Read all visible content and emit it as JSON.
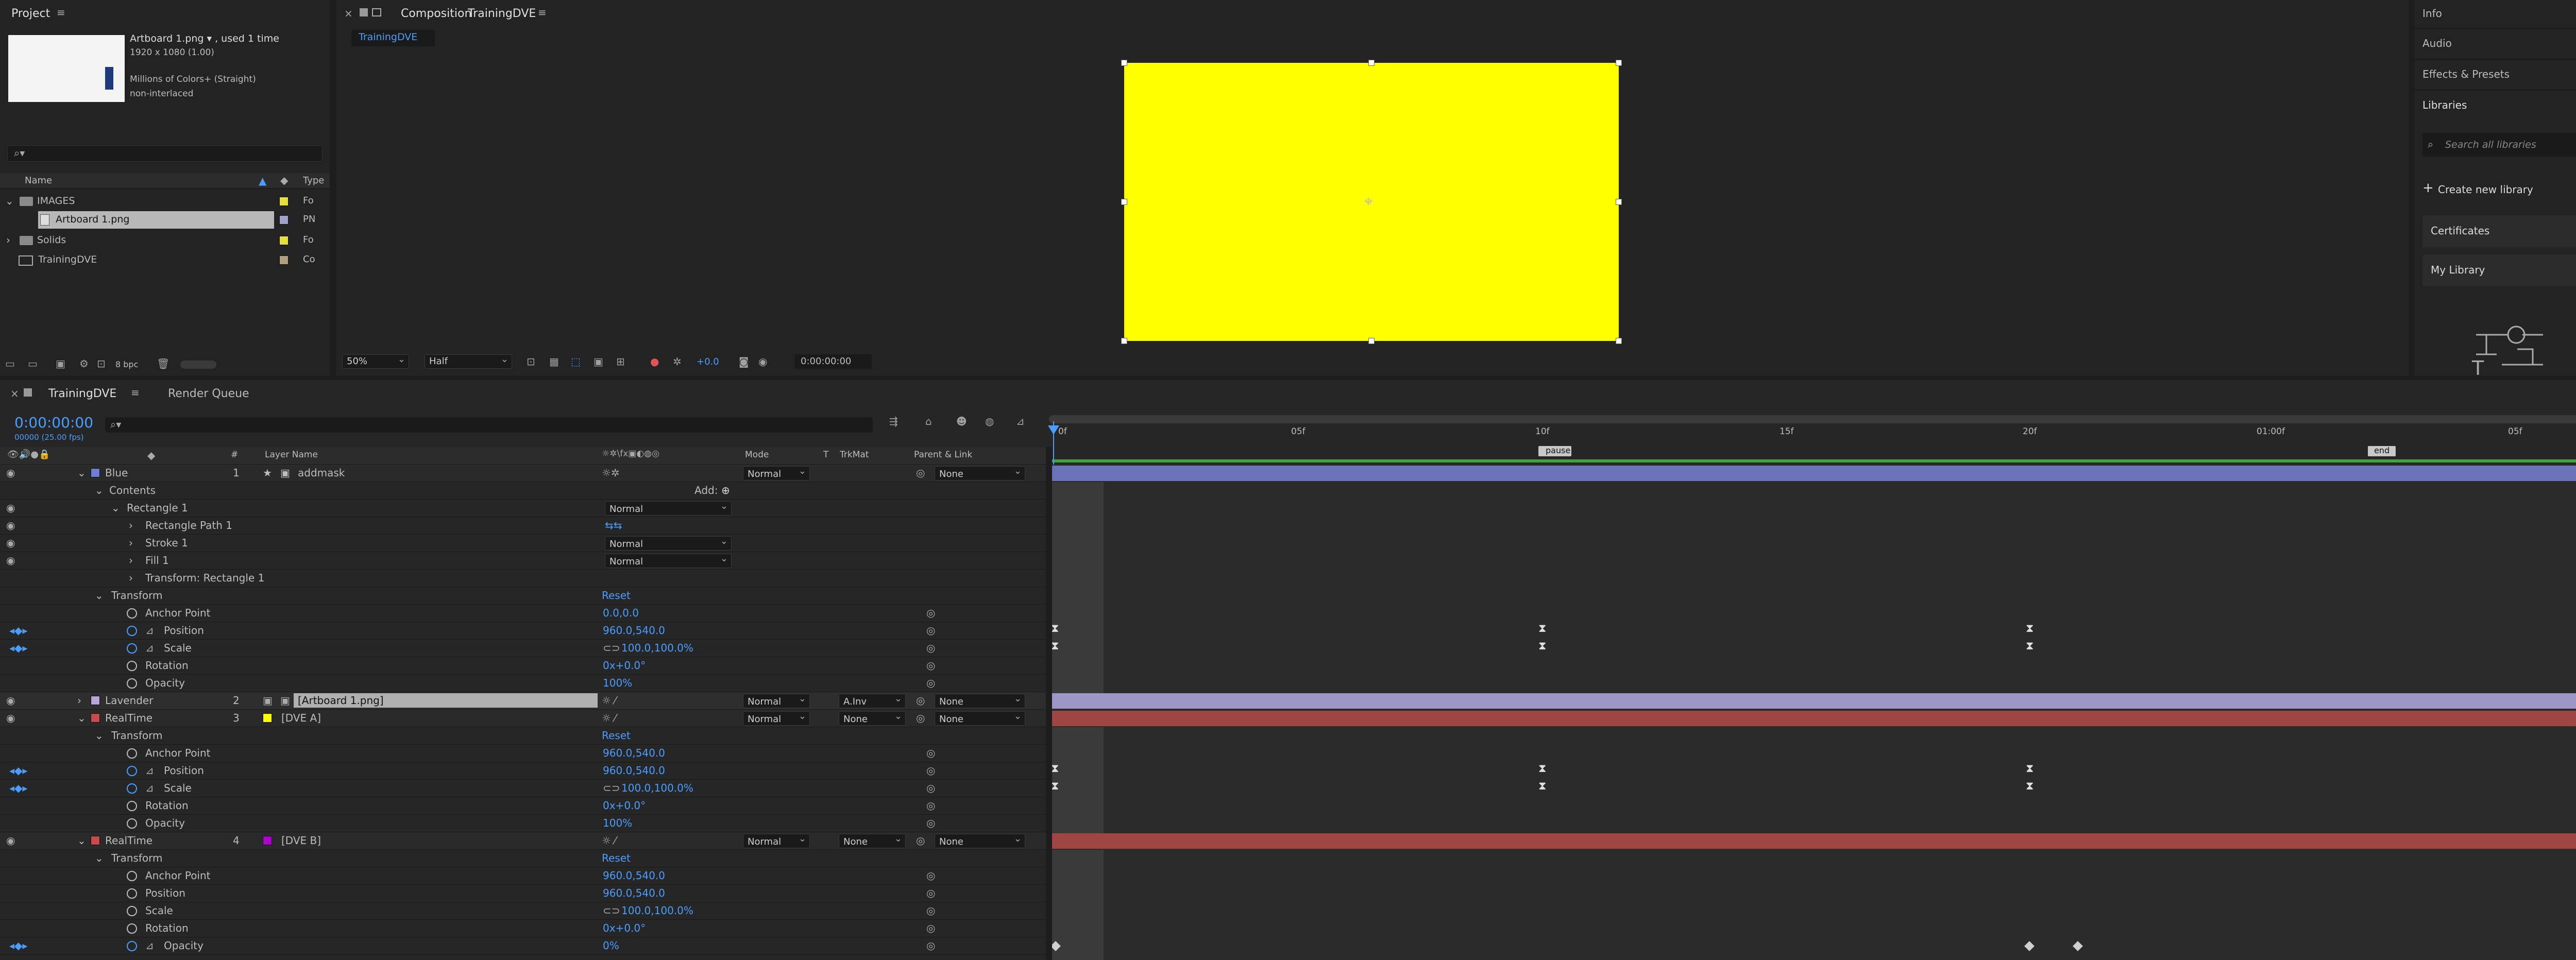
{
  "project": {
    "title": "Project",
    "asset_name": "Artboard 1.png ▾ , used 1 time",
    "asset_dims": "1920 x 1080 (1.00)",
    "asset_colors": "Millions of Colors+ (Straight)",
    "asset_scan": "non-interlaced",
    "search_icon": "⌕▾",
    "col_name": "Name",
    "col_type": "Type",
    "items": [
      {
        "name": "IMAGES",
        "color": "#e7e03a",
        "type": "Fo"
      },
      {
        "name": "Artboard 1.png",
        "color": "#a0a0c8",
        "type": "PN"
      },
      {
        "name": "Solids",
        "color": "#e7e03a",
        "type": "Fo"
      },
      {
        "name": "TrainingDVE",
        "color": "#b0a080",
        "type": "Co"
      }
    ],
    "bpc": "8 bpc"
  },
  "comp": {
    "title": "Composition",
    "name": "TrainingDVE",
    "tab": "TrainingDVE",
    "zoom": "50%",
    "resolution": "Half",
    "exposure": "+0.0",
    "timecode": "0:00:00:00",
    "canvas_color": "#ffff00"
  },
  "right": {
    "info": "Info",
    "audio": "Audio",
    "effects": "Effects & Presets",
    "libraries": "Libraries",
    "search_placeholder": "Search all libraries",
    "create": "Create new library",
    "lib1": "Certificates",
    "lib2": "My Library"
  },
  "timeline": {
    "tab": "TrainingDVE",
    "render_queue": "Render Queue",
    "timecode": "0:00:00:00",
    "fps": "00000 (25.00 fps)",
    "cols": {
      "num": "#",
      "layer_name": "Layer Name",
      "mode": "Mode",
      "t": "T",
      "trkmat": "TrkMat",
      "parent": "Parent & Link"
    },
    "ruler": [
      "0f",
      "05f",
      "10f",
      "15f",
      "20f",
      "01:00f",
      "05f"
    ],
    "markers": [
      "pause",
      "end"
    ],
    "rows": [
      {
        "label": "Blue",
        "num": "1",
        "name": "addmask",
        "mode": "Normal",
        "parent": "None"
      },
      {
        "label": "Contents",
        "add": "Add:"
      },
      {
        "label": "Rectangle 1",
        "mode": "Normal"
      },
      {
        "label": "Rectangle Path 1"
      },
      {
        "label": "Stroke 1",
        "mode": "Normal"
      },
      {
        "label": "Fill 1",
        "mode": "Normal"
      },
      {
        "label": "Transform: Rectangle 1"
      },
      {
        "label": "Transform",
        "reset": "Reset"
      },
      {
        "label": "Anchor Point",
        "value": "0.0,0.0"
      },
      {
        "label": "Position",
        "value": "960.0,540.0"
      },
      {
        "label": "Scale",
        "value": "100.0,100.0%"
      },
      {
        "label": "Rotation",
        "value": "0x+0.0°"
      },
      {
        "label": "Opacity",
        "value": "100%"
      },
      {
        "label": "Lavender",
        "num": "2",
        "name": "[Artboard 1.png]",
        "mode": "Normal",
        "trkmat": "A.Inv",
        "parent": "None"
      },
      {
        "label": "RealTime",
        "num": "3",
        "name": "[DVE A]",
        "mode": "Normal",
        "trkmat": "None",
        "parent": "None"
      },
      {
        "label": "Transform",
        "reset": "Reset"
      },
      {
        "label": "Anchor Point",
        "value": "960.0,540.0"
      },
      {
        "label": "Position",
        "value": "960.0,540.0"
      },
      {
        "label": "Scale",
        "value": "100.0,100.0%"
      },
      {
        "label": "Rotation",
        "value": "0x+0.0°"
      },
      {
        "label": "Opacity",
        "value": "100%"
      },
      {
        "label": "RealTime",
        "num": "4",
        "name": "[DVE B]",
        "mode": "Normal",
        "trkmat": "None",
        "parent": "None"
      },
      {
        "label": "Transform",
        "reset": "Reset"
      },
      {
        "label": "Anchor Point",
        "value": "960.0,540.0"
      },
      {
        "label": "Position",
        "value": "960.0,540.0"
      },
      {
        "label": "Scale",
        "value": "100.0,100.0%"
      },
      {
        "label": "Rotation",
        "value": "0x+0.0°"
      },
      {
        "label": "Opacity",
        "value": "0%"
      }
    ]
  }
}
